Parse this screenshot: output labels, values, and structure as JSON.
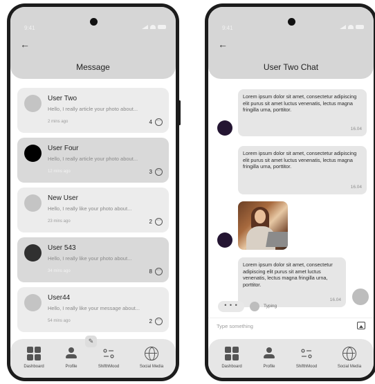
{
  "status": {
    "time": "9:41"
  },
  "message_screen": {
    "title": "Message",
    "conversations": [
      {
        "name": "User Two",
        "preview": "Hello, I really article your photo about...",
        "time": "2 mins ago",
        "count": "4",
        "avatar_color": "#c4c4c4",
        "highlighted": false
      },
      {
        "name": "User Four",
        "preview": "Hello, I really article your photo about...",
        "time": "12 mins ago",
        "count": "3",
        "avatar_color": "#000000",
        "highlighted": true
      },
      {
        "name": "New User",
        "preview": "Hello, I really like your photo about...",
        "time": "23 mins ago",
        "count": "2",
        "avatar_color": "#c4c4c4",
        "highlighted": false
      },
      {
        "name": "User 543",
        "preview": "Hello, I really like your photo about...",
        "time": "34 mins ago",
        "count": "8",
        "avatar_color": "#303030",
        "highlighted": true
      },
      {
        "name": "User44",
        "preview": "Hello, I really like your message about...",
        "time": "54 mins ago",
        "count": "2",
        "avatar_color": "#c4c4c4",
        "highlighted": false
      }
    ]
  },
  "chat_screen": {
    "title": "User Two Chat",
    "messages": [
      {
        "text": "Lorem ipsum dolor sit amet, consectetur adipiscing elit purus sit amet luctus venenatis, lectus magna fringilla urna, porttitor.",
        "time": "16.04"
      },
      {
        "text": "Lorem ipsum dolor sit amet, consectetur adipiscing elit purus sit amet luctus venenatis, lectus magna fringilla urna, porttitor.",
        "time": "16.04"
      },
      {
        "text": "Lorem ipsum dolor sit amet, consectetur adipiscing elit purus sit amet luctus venenatis, lectus magna fringilla urna, porttitor.",
        "time": "16.04"
      }
    ],
    "typing_dots": "• • •",
    "typing_label": "Typing",
    "input_placeholder": "Type something"
  },
  "nav": [
    {
      "label": "Dashboard",
      "icon": "dashboard-grid-icon"
    },
    {
      "label": "Profile",
      "icon": "person-icon"
    },
    {
      "label": "ShifthMood",
      "icon": "sliders-icon"
    },
    {
      "label": "Social Media",
      "icon": "globe-icon"
    }
  ],
  "icons": {
    "back": "←",
    "chat_bubble": "⋯",
    "edit": "✎"
  },
  "colors": {
    "header": "#d6d6d6",
    "card": "#ececec",
    "card_highlight": "#d9d9d9",
    "sender_avatar": "#241532"
  }
}
